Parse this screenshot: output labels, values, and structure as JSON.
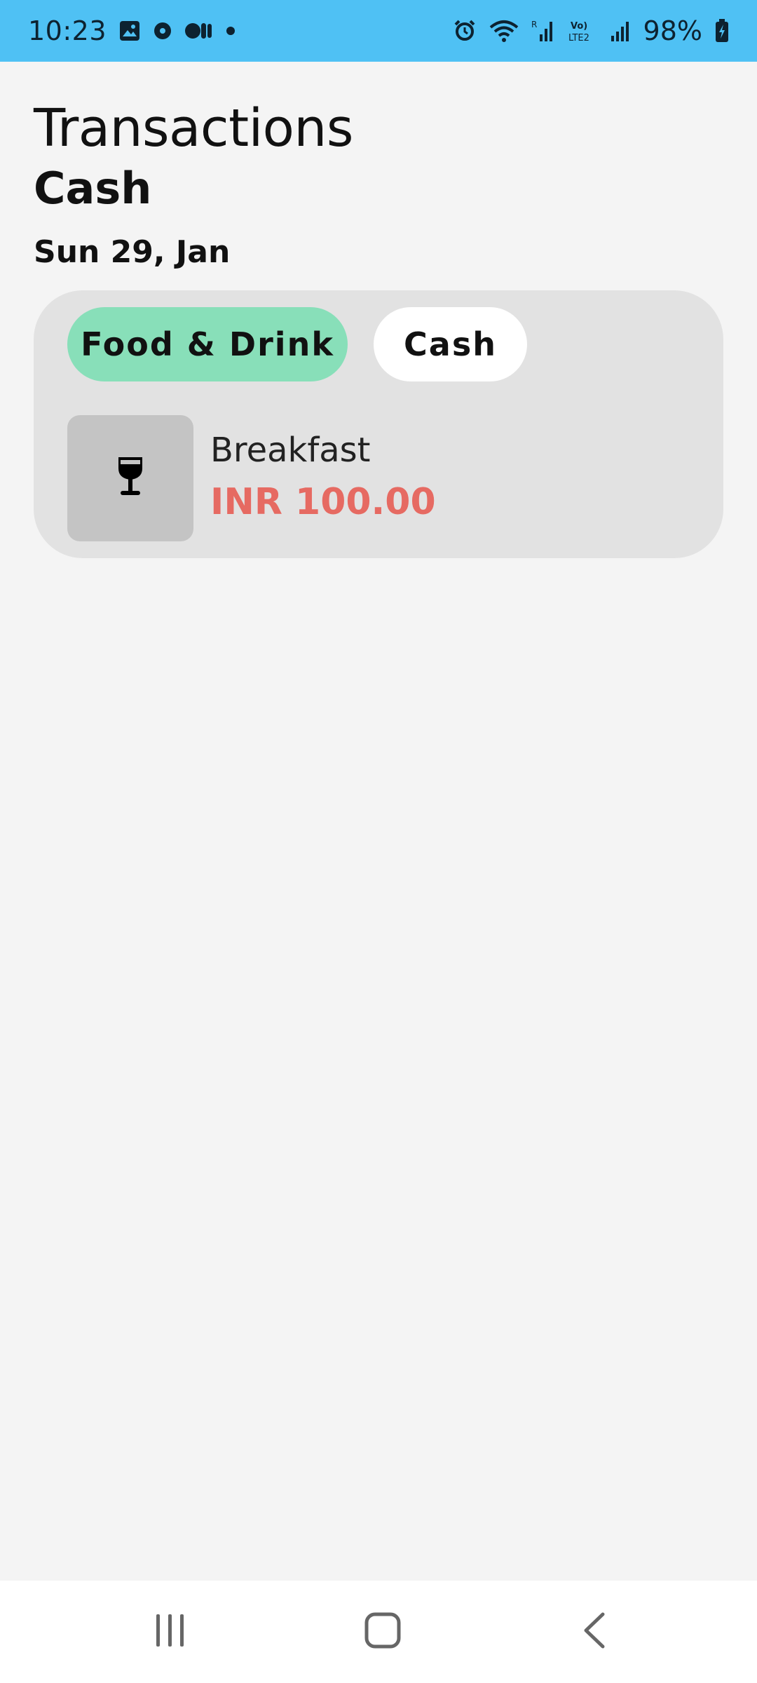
{
  "status_bar": {
    "time": "10:23",
    "battery": "98%",
    "network_label": "Vo) LTE2",
    "left_icons": [
      "gallery-icon",
      "notification-icon",
      "media-icon",
      "dot-icon"
    ],
    "right_icons": [
      "alarm-icon",
      "wifi-icon",
      "signal-icon",
      "volte-icon",
      "signal-icon",
      "battery-charging-icon"
    ],
    "background_color": "#4fc1f4"
  },
  "header": {
    "title": "Transactions",
    "account": "Cash"
  },
  "date_group": {
    "date": "Sun 29, Jan"
  },
  "transaction": {
    "category_chip": "Food & Drink",
    "account_chip": "Cash",
    "icon": "wine-glass-icon",
    "title": "Breakfast",
    "amount": "INR 100.00",
    "category_color": "#88dfb9",
    "amount_color": "#e66a62"
  },
  "nav_bar": {
    "buttons": [
      "recents-icon",
      "home-icon",
      "back-icon"
    ]
  }
}
